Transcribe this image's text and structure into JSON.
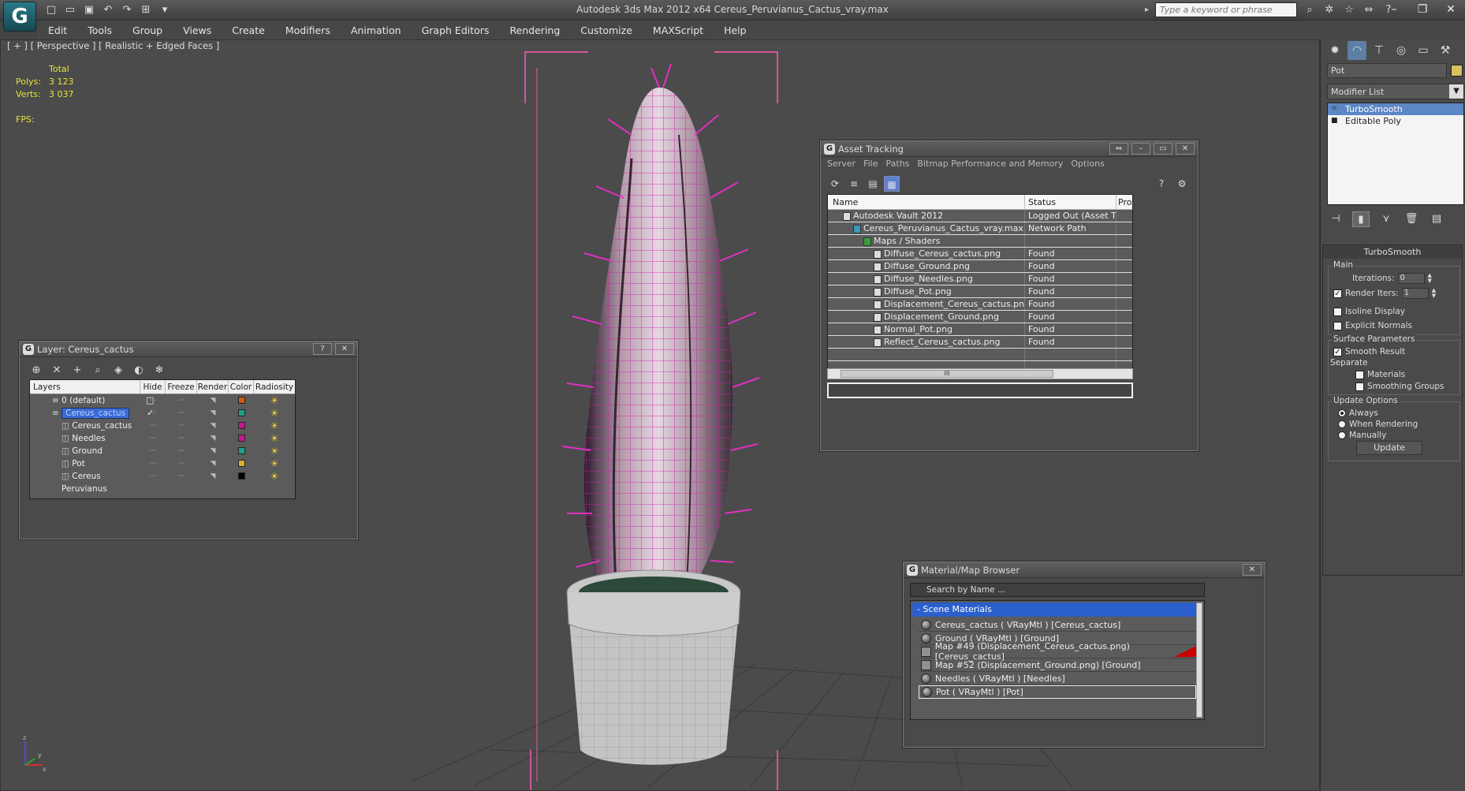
{
  "window": {
    "app_logo": "G",
    "title": "Autodesk 3ds Max  2012 x64      Cereus_Peruvianus_Cactus_vray.max",
    "search_placeholder": "Type a keyword or phrase"
  },
  "menu": [
    "Edit",
    "Tools",
    "Group",
    "Views",
    "Create",
    "Modifiers",
    "Animation",
    "Graph Editors",
    "Rendering",
    "Customize",
    "MAXScript",
    "Help"
  ],
  "viewport": {
    "label": "[ + ] [ Perspective ] [ Realistic + Edged Faces ]",
    "stats_header": "Total",
    "polys_label": "Polys:",
    "polys_value": "3 123",
    "verts_label": "Verts:",
    "verts_value": "3 037",
    "fps_label": "FPS:",
    "axis_x": "x",
    "axis_y": "y",
    "axis_z": "z"
  },
  "command_panel": {
    "object_name": "Pot",
    "object_color": "#d8c060",
    "modifier_list": "Modifier List",
    "stack": [
      "TurboSmooth",
      "Editable Poly"
    ],
    "rollout_title": "TurboSmooth",
    "main_group": "Main",
    "iterations_label": "Iterations:",
    "iterations_value": "0",
    "render_iters_label": "Render Iters:",
    "render_iters_value": "1",
    "isoline_label": "Isoline Display",
    "explicit_normals_label": "Explicit Normals",
    "surface_params_group": "Surface Parameters",
    "smooth_result_label": "Smooth Result",
    "separate_label": "Separate",
    "materials_label": "Materials",
    "smoothing_groups_label": "Smoothing Groups",
    "update_options_group": "Update Options",
    "always_label": "Always",
    "when_rendering_label": "When Rendering",
    "manually_label": "Manually",
    "update_button": "Update"
  },
  "layer_window": {
    "title": "Layer: Cereus_cactus",
    "help_btn": "?",
    "close_btn": "✕",
    "columns": [
      "Layers",
      "Hide",
      "Freeze",
      "Render",
      "Color",
      "Radiosity"
    ],
    "rows": [
      {
        "name": "0 (default)",
        "color": "#d05a10",
        "indent": 0
      },
      {
        "name": "Cereus_cactus",
        "color": "#20a080",
        "indent": 0
      },
      {
        "name": "Cereus_cactus",
        "color": "#c81890",
        "indent": 1
      },
      {
        "name": "Needles",
        "color": "#c81890",
        "indent": 1
      },
      {
        "name": "Ground",
        "color": "#20a090",
        "indent": 1
      },
      {
        "name": "Pot",
        "color": "#d8b030",
        "indent": 1
      },
      {
        "name": "Cereus Peruvianus",
        "color": "#000000",
        "indent": 1
      }
    ]
  },
  "asset_window": {
    "title": "Asset Tracking",
    "menu": [
      "Server",
      "File",
      "Paths",
      "Bitmap Performance and Memory",
      "Options"
    ],
    "columns": [
      "Name",
      "Status",
      "Pro"
    ],
    "rows": [
      {
        "name": "Autodesk Vault 2012",
        "status": "Logged Out (Asset Tr...",
        "indent": 1
      },
      {
        "name": "Cereus_Peruvianus_Cactus_vray.max",
        "status": "Network Path",
        "indent": 2
      },
      {
        "name": "Maps / Shaders",
        "status": "",
        "indent": 3
      },
      {
        "name": "Diffuse_Cereus_cactus.png",
        "status": "Found",
        "indent": 4
      },
      {
        "name": "Diffuse_Ground.png",
        "status": "Found",
        "indent": 4
      },
      {
        "name": "Diffuse_Needles.png",
        "status": "Found",
        "indent": 4
      },
      {
        "name": "Diffuse_Pot.png",
        "status": "Found",
        "indent": 4
      },
      {
        "name": "Displacement_Cereus_cactus.png",
        "status": "Found",
        "indent": 4
      },
      {
        "name": "Displacement_Ground.png",
        "status": "Found",
        "indent": 4
      },
      {
        "name": "Normal_Pot.png",
        "status": "Found",
        "indent": 4
      },
      {
        "name": "Reflect_Cereus_cactus.png",
        "status": "Found",
        "indent": 4
      }
    ],
    "scroll_label": "III"
  },
  "material_window": {
    "title": "Material/Map Browser",
    "close_btn": "✕",
    "search_placeholder": "Search by Name ...",
    "group": "- Scene Materials",
    "items": [
      {
        "label": "Cereus_cactus  ( VRayMtl ) [Cereus_cactus]",
        "kind": "sphere",
        "flag": false
      },
      {
        "label": "Ground  ( VRayMtl ) [Ground]",
        "kind": "sphere",
        "flag": false
      },
      {
        "label": "Map #49 (Displacement_Cereus_cactus.png) [Cereus_cactus]",
        "kind": "map",
        "flag": true
      },
      {
        "label": "Map #52 (Displacement_Ground.png) [Ground]",
        "kind": "map",
        "flag": false
      },
      {
        "label": "Needles  ( VRayMtl ) [Needles]",
        "kind": "sphere",
        "flag": false
      },
      {
        "label": "Pot  ( VRayMtl ) [Pot]",
        "kind": "sphere",
        "flag": false
      }
    ]
  }
}
